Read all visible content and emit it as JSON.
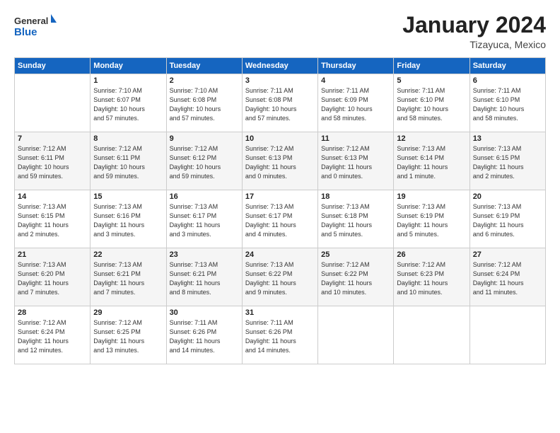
{
  "header": {
    "logo_general": "General",
    "logo_blue": "Blue",
    "month_title": "January 2024",
    "location": "Tizayuca, Mexico"
  },
  "weekdays": [
    "Sunday",
    "Monday",
    "Tuesday",
    "Wednesday",
    "Thursday",
    "Friday",
    "Saturday"
  ],
  "weeks": [
    [
      {
        "day": "",
        "info": ""
      },
      {
        "day": "1",
        "info": "Sunrise: 7:10 AM\nSunset: 6:07 PM\nDaylight: 10 hours\nand 57 minutes."
      },
      {
        "day": "2",
        "info": "Sunrise: 7:10 AM\nSunset: 6:08 PM\nDaylight: 10 hours\nand 57 minutes."
      },
      {
        "day": "3",
        "info": "Sunrise: 7:11 AM\nSunset: 6:08 PM\nDaylight: 10 hours\nand 57 minutes."
      },
      {
        "day": "4",
        "info": "Sunrise: 7:11 AM\nSunset: 6:09 PM\nDaylight: 10 hours\nand 58 minutes."
      },
      {
        "day": "5",
        "info": "Sunrise: 7:11 AM\nSunset: 6:10 PM\nDaylight: 10 hours\nand 58 minutes."
      },
      {
        "day": "6",
        "info": "Sunrise: 7:11 AM\nSunset: 6:10 PM\nDaylight: 10 hours\nand 58 minutes."
      }
    ],
    [
      {
        "day": "7",
        "info": "Sunrise: 7:12 AM\nSunset: 6:11 PM\nDaylight: 10 hours\nand 59 minutes."
      },
      {
        "day": "8",
        "info": "Sunrise: 7:12 AM\nSunset: 6:11 PM\nDaylight: 10 hours\nand 59 minutes."
      },
      {
        "day": "9",
        "info": "Sunrise: 7:12 AM\nSunset: 6:12 PM\nDaylight: 10 hours\nand 59 minutes."
      },
      {
        "day": "10",
        "info": "Sunrise: 7:12 AM\nSunset: 6:13 PM\nDaylight: 11 hours\nand 0 minutes."
      },
      {
        "day": "11",
        "info": "Sunrise: 7:12 AM\nSunset: 6:13 PM\nDaylight: 11 hours\nand 0 minutes."
      },
      {
        "day": "12",
        "info": "Sunrise: 7:13 AM\nSunset: 6:14 PM\nDaylight: 11 hours\nand 1 minute."
      },
      {
        "day": "13",
        "info": "Sunrise: 7:13 AM\nSunset: 6:15 PM\nDaylight: 11 hours\nand 2 minutes."
      }
    ],
    [
      {
        "day": "14",
        "info": "Sunrise: 7:13 AM\nSunset: 6:15 PM\nDaylight: 11 hours\nand 2 minutes."
      },
      {
        "day": "15",
        "info": "Sunrise: 7:13 AM\nSunset: 6:16 PM\nDaylight: 11 hours\nand 3 minutes."
      },
      {
        "day": "16",
        "info": "Sunrise: 7:13 AM\nSunset: 6:17 PM\nDaylight: 11 hours\nand 3 minutes."
      },
      {
        "day": "17",
        "info": "Sunrise: 7:13 AM\nSunset: 6:17 PM\nDaylight: 11 hours\nand 4 minutes."
      },
      {
        "day": "18",
        "info": "Sunrise: 7:13 AM\nSunset: 6:18 PM\nDaylight: 11 hours\nand 5 minutes."
      },
      {
        "day": "19",
        "info": "Sunrise: 7:13 AM\nSunset: 6:19 PM\nDaylight: 11 hours\nand 5 minutes."
      },
      {
        "day": "20",
        "info": "Sunrise: 7:13 AM\nSunset: 6:19 PM\nDaylight: 11 hours\nand 6 minutes."
      }
    ],
    [
      {
        "day": "21",
        "info": "Sunrise: 7:13 AM\nSunset: 6:20 PM\nDaylight: 11 hours\nand 7 minutes."
      },
      {
        "day": "22",
        "info": "Sunrise: 7:13 AM\nSunset: 6:21 PM\nDaylight: 11 hours\nand 7 minutes."
      },
      {
        "day": "23",
        "info": "Sunrise: 7:13 AM\nSunset: 6:21 PM\nDaylight: 11 hours\nand 8 minutes."
      },
      {
        "day": "24",
        "info": "Sunrise: 7:13 AM\nSunset: 6:22 PM\nDaylight: 11 hours\nand 9 minutes."
      },
      {
        "day": "25",
        "info": "Sunrise: 7:12 AM\nSunset: 6:22 PM\nDaylight: 11 hours\nand 10 minutes."
      },
      {
        "day": "26",
        "info": "Sunrise: 7:12 AM\nSunset: 6:23 PM\nDaylight: 11 hours\nand 10 minutes."
      },
      {
        "day": "27",
        "info": "Sunrise: 7:12 AM\nSunset: 6:24 PM\nDaylight: 11 hours\nand 11 minutes."
      }
    ],
    [
      {
        "day": "28",
        "info": "Sunrise: 7:12 AM\nSunset: 6:24 PM\nDaylight: 11 hours\nand 12 minutes."
      },
      {
        "day": "29",
        "info": "Sunrise: 7:12 AM\nSunset: 6:25 PM\nDaylight: 11 hours\nand 13 minutes."
      },
      {
        "day": "30",
        "info": "Sunrise: 7:11 AM\nSunset: 6:26 PM\nDaylight: 11 hours\nand 14 minutes."
      },
      {
        "day": "31",
        "info": "Sunrise: 7:11 AM\nSunset: 6:26 PM\nDaylight: 11 hours\nand 14 minutes."
      },
      {
        "day": "",
        "info": ""
      },
      {
        "day": "",
        "info": ""
      },
      {
        "day": "",
        "info": ""
      }
    ]
  ]
}
